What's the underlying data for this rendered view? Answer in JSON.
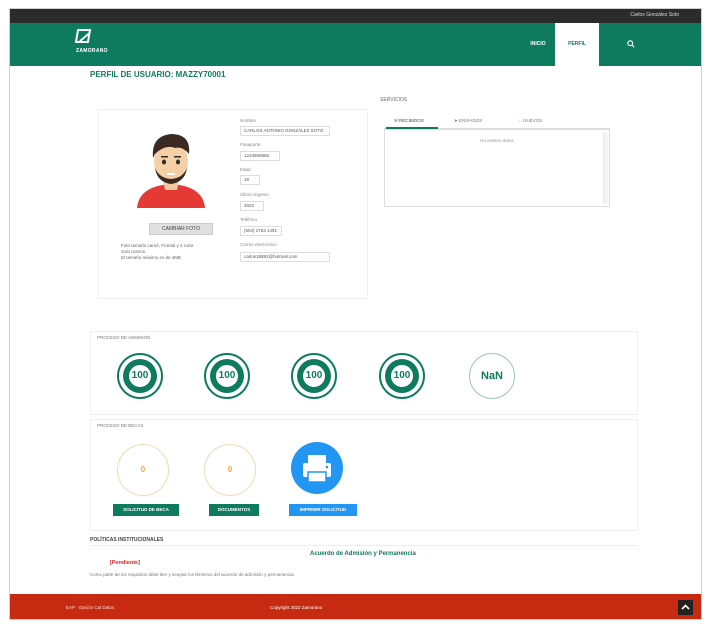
{
  "topbar": {
    "user_name": "Carlos González Soto"
  },
  "navbar": {
    "logo_text": "ZAMORANO",
    "items": [
      {
        "label": "INICIO"
      },
      {
        "label": "PERFIL"
      }
    ],
    "search_icon": "search-icon"
  },
  "page": {
    "title": "PERFIL DE USUARIO: MAZZY70001"
  },
  "profile": {
    "change_photo_label": "CAMBIAR FOTO",
    "photo_note_line1": "Foto tamaño carné, Frontal y a color.",
    "photo_note_line2": "Solo rostros.",
    "photo_note_line3": "El tamaño máximo es de 4MB",
    "fields": [
      {
        "label": "Nombre",
        "value": "CARLOS ANTONIO GONZÁLEZ SOTO"
      },
      {
        "label": "Pasaporte",
        "value": "1234566856"
      },
      {
        "label": "Edad",
        "value": "18"
      },
      {
        "label": "Último ingreso",
        "value": "2022"
      },
      {
        "label": "Teléfono",
        "value": "(504) 2763 1491"
      },
      {
        "label": "Correo electrónico",
        "value": "carlos18882@hotmail.com"
      }
    ]
  },
  "services": {
    "title": "SERVICIOS",
    "tabs": [
      {
        "label": "RECIBIDOS",
        "icon": "inbox-icon"
      },
      {
        "label": "ENVIADOS",
        "icon": "send-icon"
      },
      {
        "label": "NUEVOS",
        "icon": "star-icon"
      }
    ],
    "empty_message": "No existen datos"
  },
  "admision": {
    "title": "PROCESO DE ADMISIÓN",
    "progress": [
      "100",
      "100",
      "100",
      "100",
      "NaN"
    ]
  },
  "becas": {
    "title": "PROCESO DE BECAS",
    "counters": [
      "0",
      "0"
    ],
    "buttons": {
      "solicitud": "SOLICITUD DE BECA",
      "documentos": "DOCUMENTOS",
      "imprimir": "IMPRIMIR SOLICITUD"
    },
    "print_icon": "printer-icon"
  },
  "politicas": {
    "title": "POLÍTICAS INSTITUCIONALES",
    "link": "Acuerdo de Admisión y Permanencia",
    "status": "[Pendiente]",
    "note": "Como parte de los requisitos debe leer y aceptar los términos del acuerdo de admisión y permanencia."
  },
  "footer": {
    "left": "EAP · Opción Cal Datos",
    "center": "Copyright 2022 Zamorano"
  },
  "colors": {
    "brand_green": "#0e7b5f",
    "footer_red": "#c62b12",
    "accent_blue": "#2196f3",
    "accent_orange": "#e9a84c"
  }
}
